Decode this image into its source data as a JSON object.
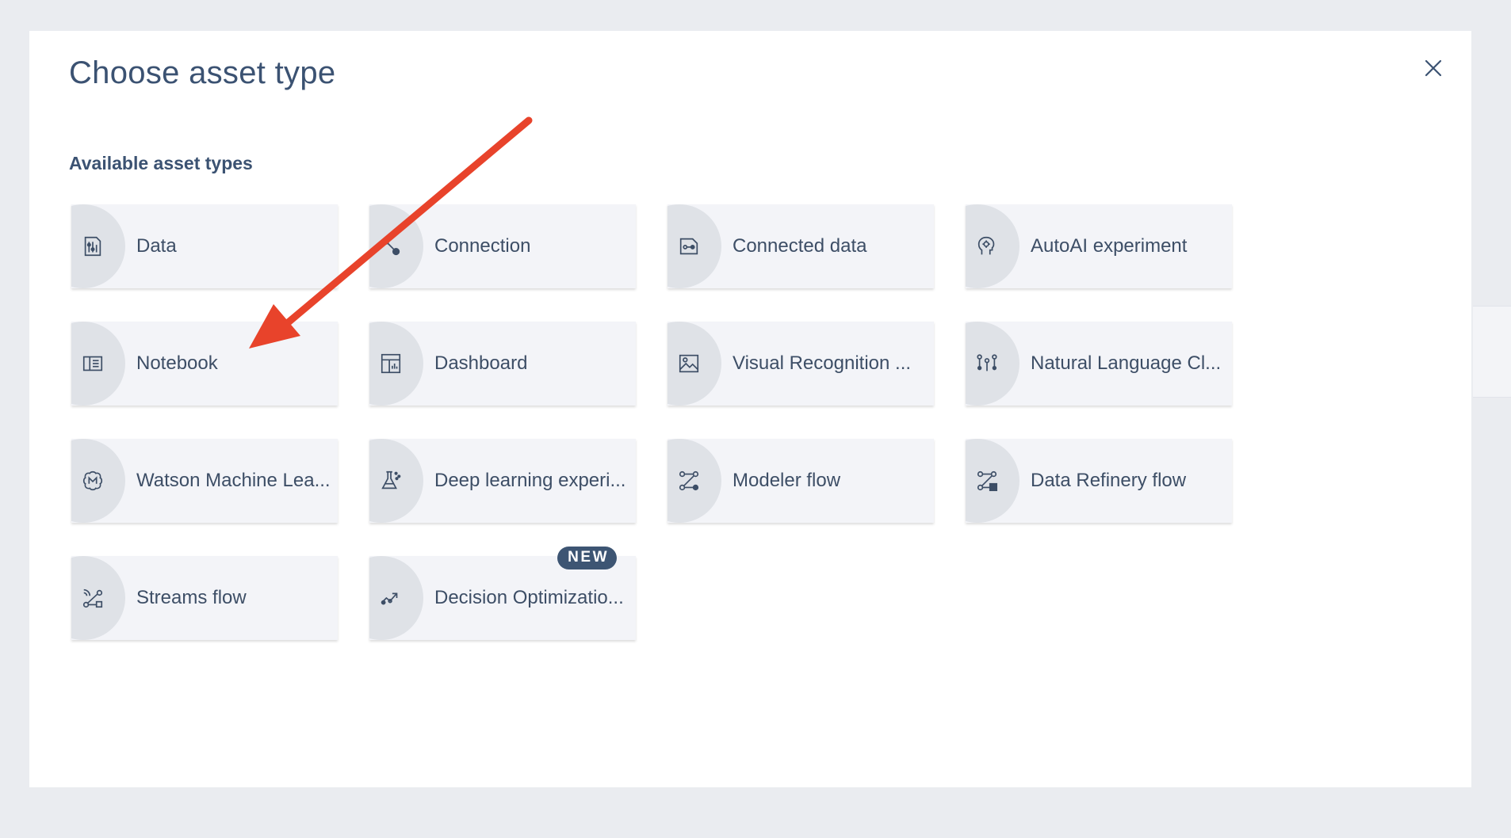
{
  "modal": {
    "title": "Choose asset type",
    "close_icon": "close-icon",
    "section_title": "Available asset types"
  },
  "tiles": [
    {
      "label": "Data",
      "icon": "data-icon"
    },
    {
      "label": "Connection",
      "icon": "connection-icon"
    },
    {
      "label": "Connected data",
      "icon": "connected-data-icon"
    },
    {
      "label": "AutoAI experiment",
      "icon": "autoai-icon"
    },
    {
      "label": "Notebook",
      "icon": "notebook-icon"
    },
    {
      "label": "Dashboard",
      "icon": "dashboard-icon"
    },
    {
      "label": "Visual Recognition ...",
      "icon": "visual-recognition-icon"
    },
    {
      "label": "Natural Language Cl...",
      "icon": "natural-language-icon"
    },
    {
      "label": "Watson Machine Lea...",
      "icon": "machine-learning-icon"
    },
    {
      "label": "Deep learning experi...",
      "icon": "flask-icon"
    },
    {
      "label": "Modeler flow",
      "icon": "flow-icon"
    },
    {
      "label": "Data Refinery flow",
      "icon": "refinery-flow-icon"
    },
    {
      "label": "Streams flow",
      "icon": "streams-flow-icon"
    },
    {
      "label": "Decision Optimizatio...",
      "icon": "decision-icon",
      "badge": "NEW"
    }
  ],
  "colors": {
    "accent": "#3d5573",
    "annotation_arrow": "#e8432b",
    "tile_bg": "#f3f4f8",
    "page_bg": "#eaecf0"
  }
}
